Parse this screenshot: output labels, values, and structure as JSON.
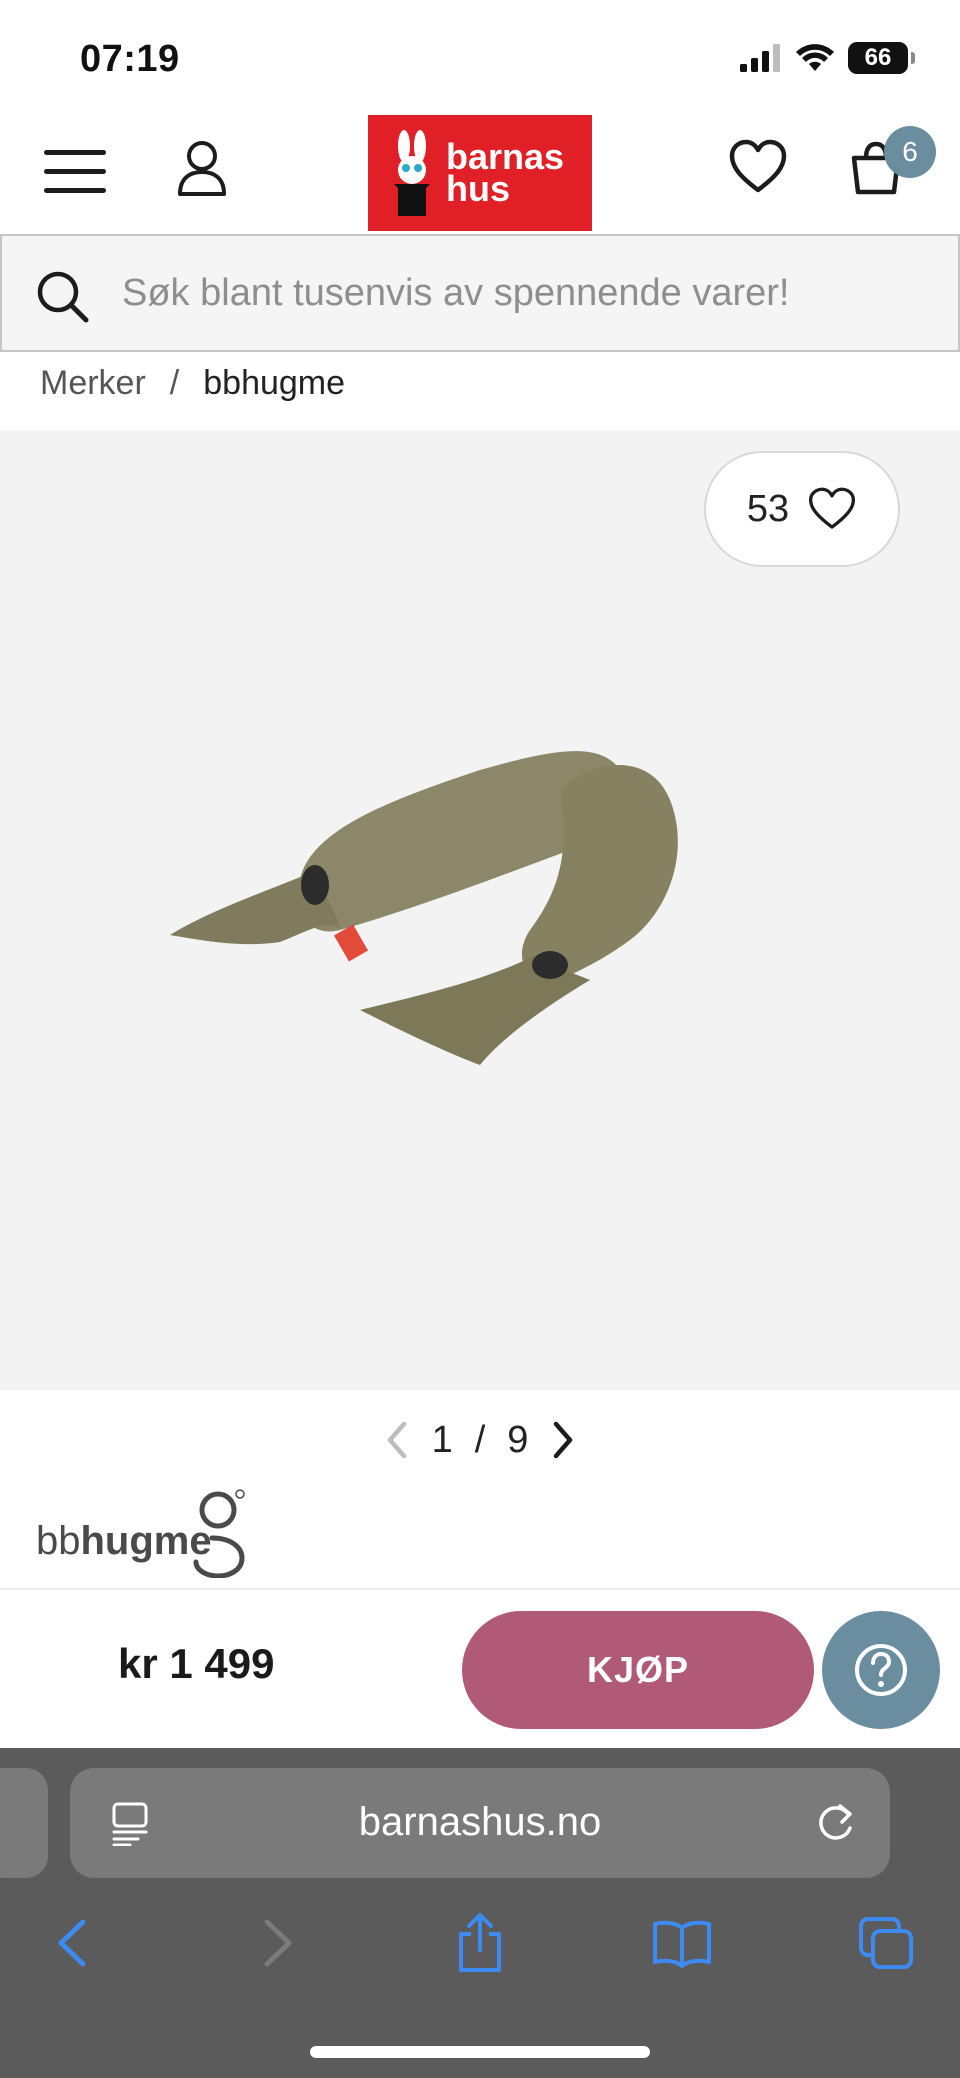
{
  "status_bar": {
    "time": "07:19",
    "battery": "66"
  },
  "header": {
    "logo_line1": "barnas",
    "logo_line2": "hus",
    "cart_count": "6"
  },
  "search": {
    "placeholder": "Søk blant tusenvis av spennende varer!"
  },
  "breadcrumb": {
    "link": "Merker",
    "separator": "/",
    "current": "bbhugme"
  },
  "product": {
    "likes": "53",
    "pager_current": "1",
    "pager_sep": "/",
    "pager_total": "9",
    "brand": {
      "prefix": "bb",
      "suffix": "hugme"
    },
    "price": "kr 1 499",
    "buy_label": "KJØP",
    "pillow_color": "#8b8768"
  },
  "browser": {
    "url": "barnashus.no"
  }
}
